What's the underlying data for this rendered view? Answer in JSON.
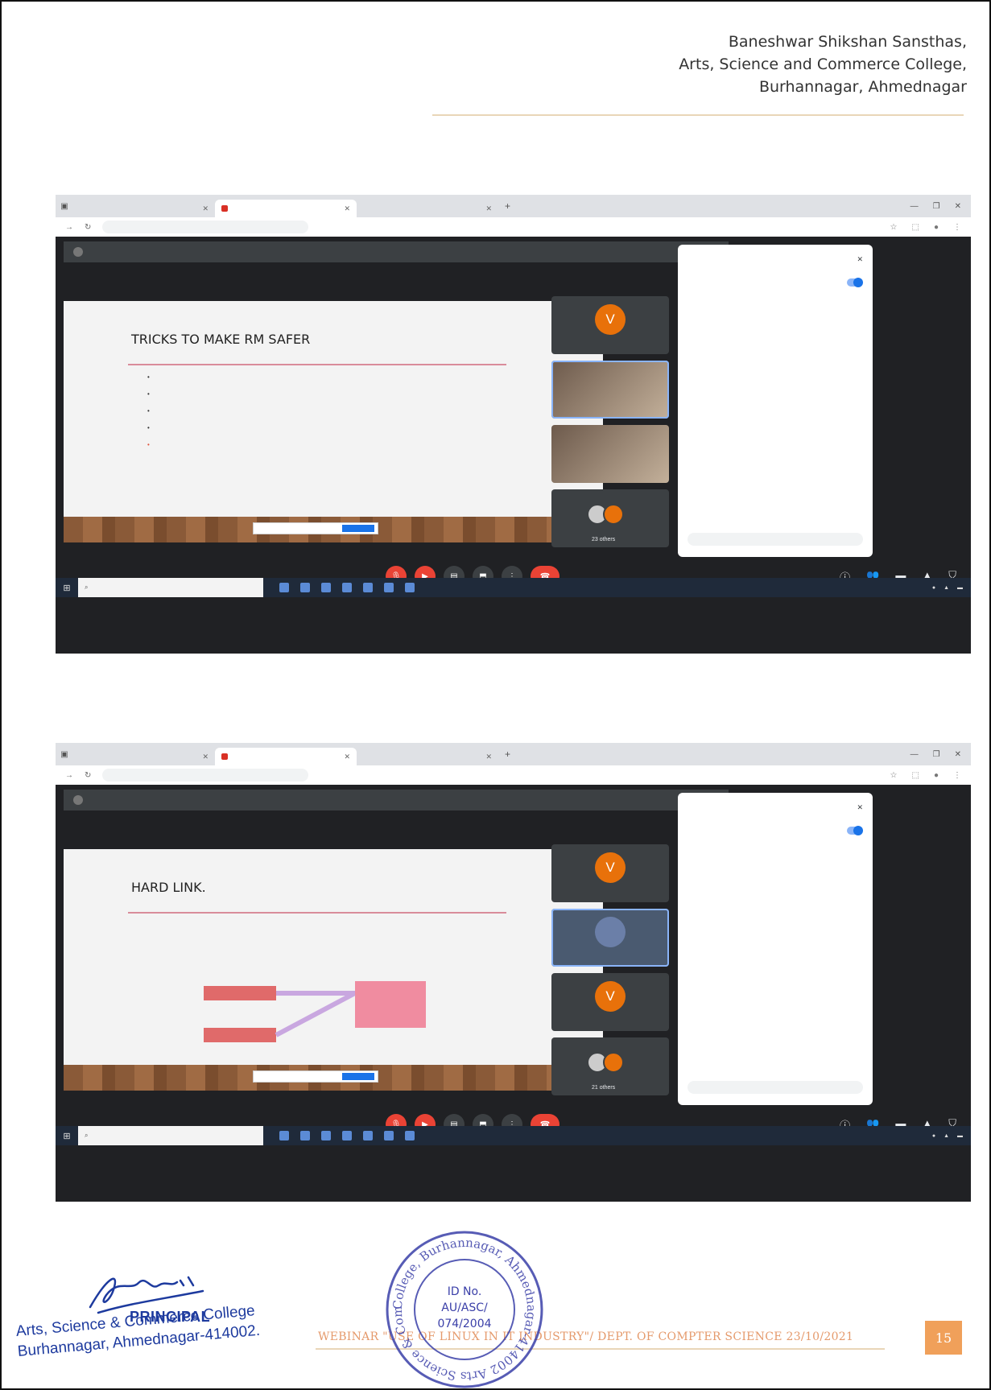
{
  "header": {
    "line1": "Baneshwar Shikshan Sansthas,",
    "line2": "Arts, Science and Commerce College,",
    "line3": "Burhannagar, Ahmednagar"
  },
  "screenshots": [
    {
      "slide_title": "TRICKS TO MAKE RM SAFER",
      "slide_type": "bullets",
      "participants_others": "23 others"
    },
    {
      "slide_title": "HARD LINK.",
      "slide_type": "hardlink",
      "participants_others": "21 others"
    }
  ],
  "footer": {
    "webinar_text": "WEBINAR \"USE OF LINUX IN IT INDUSTRY\"/ DEPT. OF COMPTER SCIENCE 23/10/2021",
    "page_number": "15"
  },
  "principal": {
    "title": "PRINCIPAL",
    "line1": "Arts, Science & Commerce College",
    "line2": "Burhannagar, Ahmednagar-414002."
  },
  "seal": {
    "ring_text": "College, Burhannagar, Ahmednagar-414002 Arts Science & Commerce",
    "id_label": "ID No.",
    "id_code": "AU/ASC/",
    "id_num": "074/2004"
  },
  "colors": {
    "accent_orange": "#f0a05a",
    "footer_text": "#e59a6c",
    "stamp_blue": "#1d3a9e",
    "meet_bg": "#202124"
  }
}
